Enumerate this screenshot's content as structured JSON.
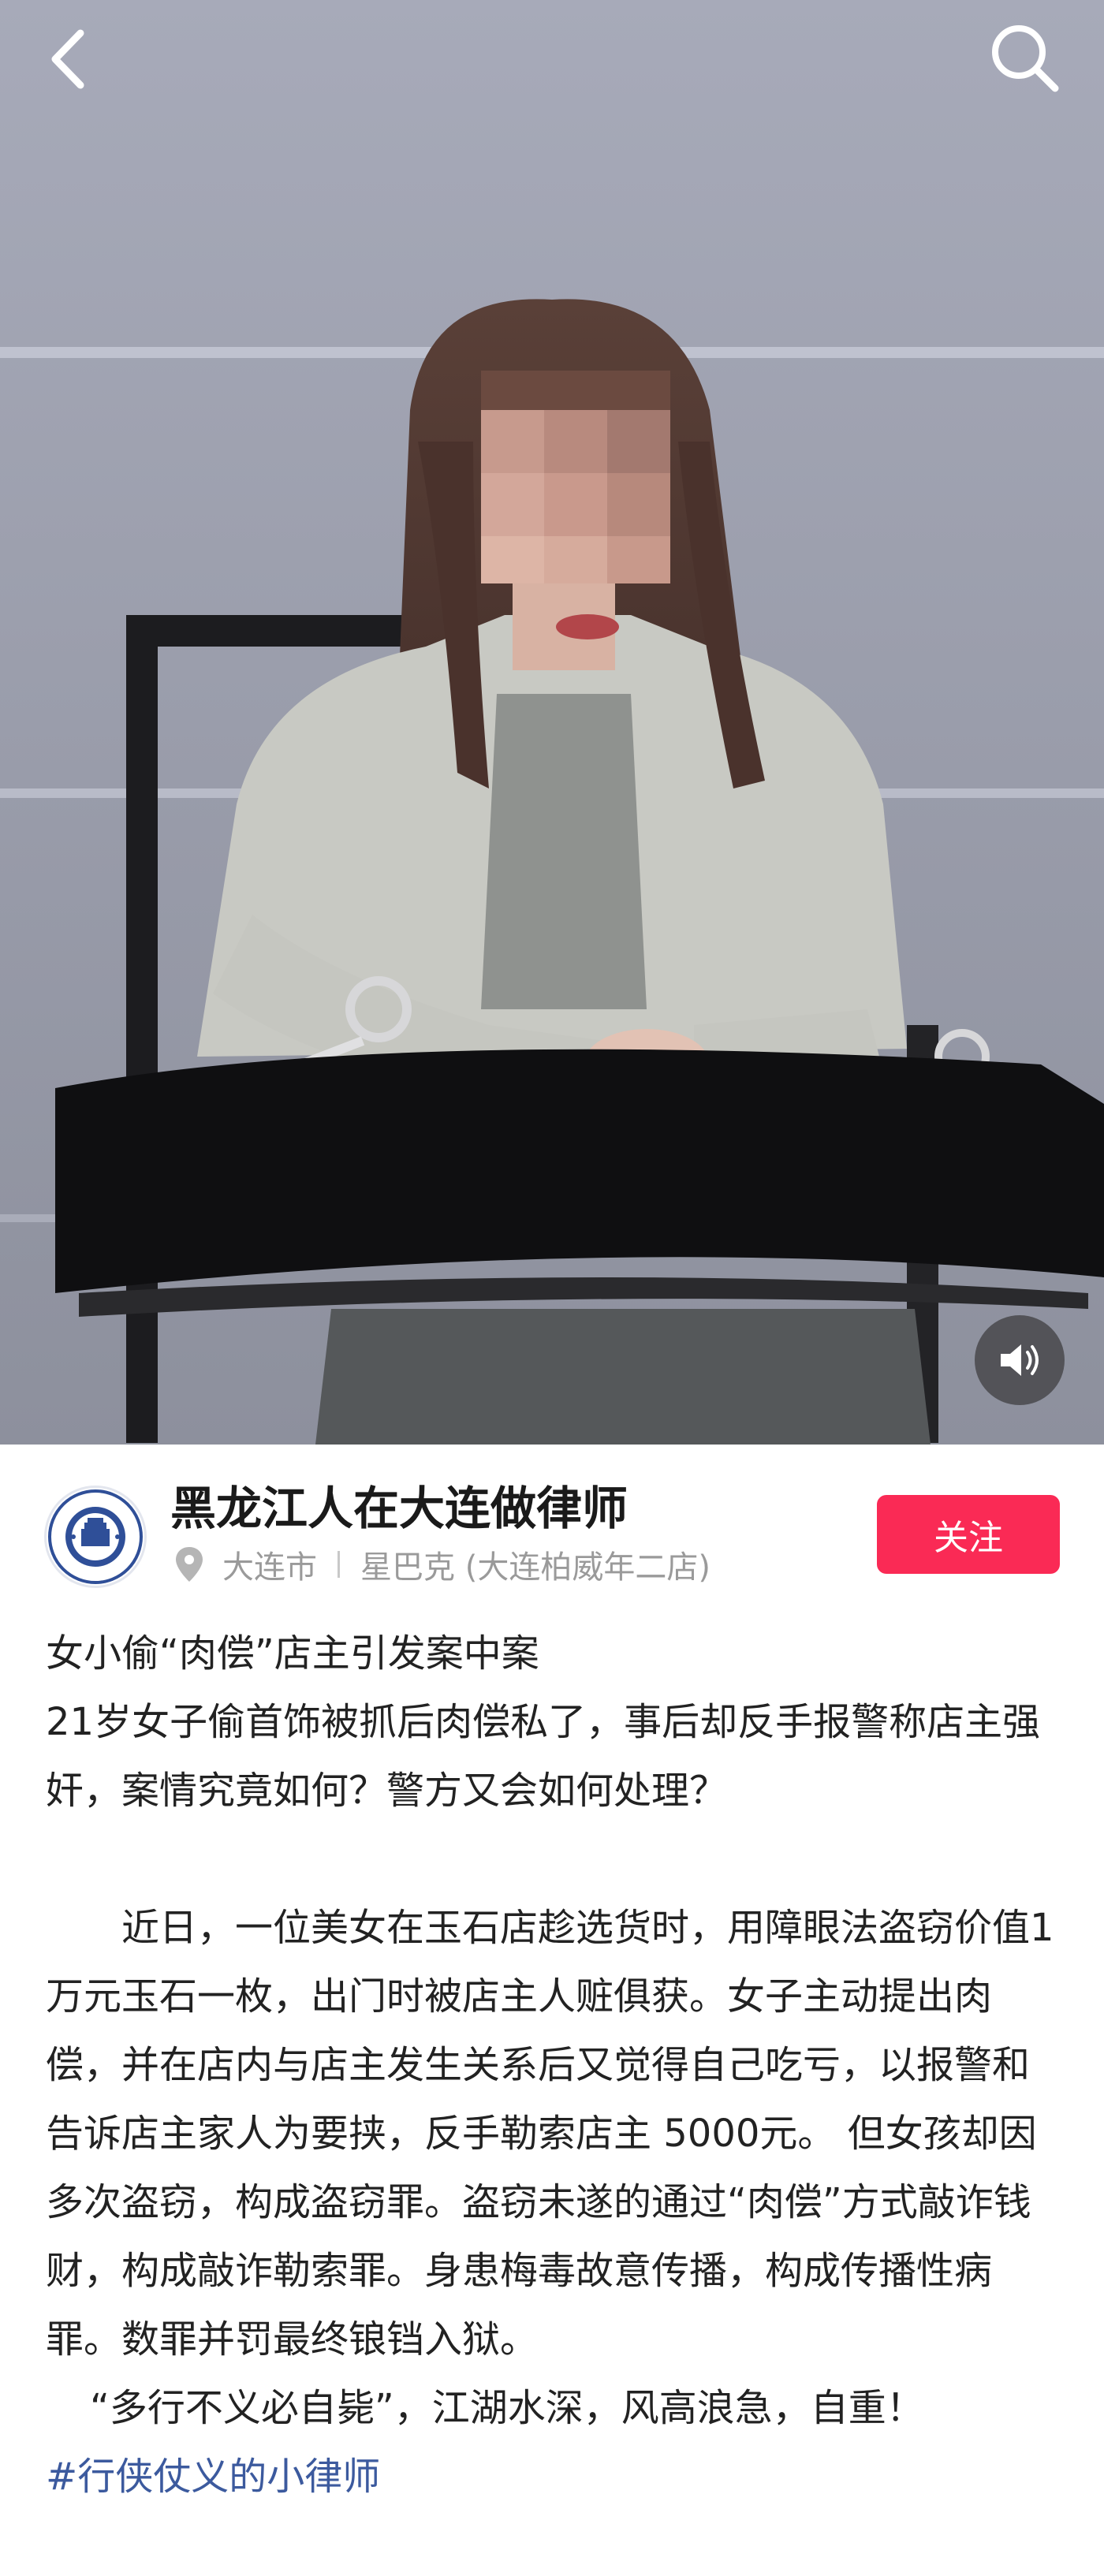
{
  "nav": {
    "back_icon": "chevron-left-icon",
    "search_icon": "search-icon"
  },
  "media": {
    "sound_icon": "speaker-icon"
  },
  "author": {
    "name": "黑龙江人在大连做律师",
    "avatar_icon": "chinese-lawyer-logo",
    "city": "大连市",
    "place": "星巴克 (大连柏威年二店)",
    "follow_label": "关注"
  },
  "post": {
    "title": "女小偷“肉偿”店主引发案中案",
    "subtitle": "21岁女子偷首饰被抓后肉偿私了，事后却反手报警称店主强奸，案情究竟如何？警方又会如何处理？",
    "paragraph1": "近日，一位美女在玉石店趁选货时，用障眼法盗窃价值1万元玉石一枚，出门时被店主人赃俱获。女子主动提出肉偿，并在店内与店主发生关系后又觉得自己吃亏，以报警和告诉店主家人为要挟，反手勒索店主 5000元。 但女孩却因多次盗窃，构成盗窃罪。盗窃未遂的通过“肉偿”方式敲诈钱财，构成敲诈勒索罪。身患梅毒故意传播，构成传播性病罪。数罪并罚最终锒铛入狱。",
    "paragraph2": "“多行不义必自毙”，江湖水深，风高浪急，自重！",
    "hashtag": "#行侠仗义的小律师"
  },
  "colors": {
    "follow_button": "#fa2a55",
    "hashtag": "#3c5a9e",
    "meta_text": "#9a9a9a"
  }
}
